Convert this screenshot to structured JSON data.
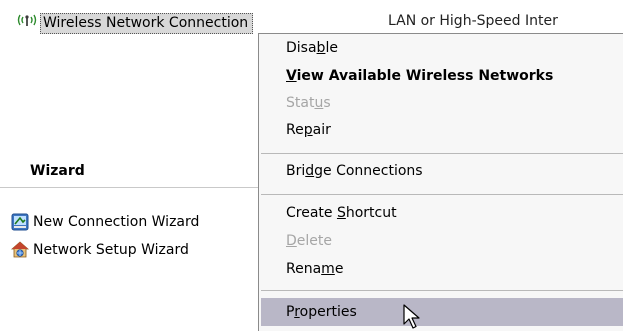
{
  "connection_row": {
    "name": "Wireless Network Connection",
    "type_prefix": "LAN or High-Speed Inter",
    "icon": "wireless-signal-icon"
  },
  "wizard_panel": {
    "heading": "Wizard",
    "items": [
      {
        "label": "New Connection Wizard",
        "icon": "new-connection-wizard-icon"
      },
      {
        "label": "Network Setup Wizard",
        "icon": "network-setup-wizard-icon"
      }
    ]
  },
  "context_menu": {
    "items": [
      {
        "label_pre": "Disa",
        "label_u": "b",
        "label_post": "le",
        "state": "enabled"
      },
      {
        "label_pre": "",
        "label_u": "V",
        "label_post": "iew Available Wireless Networks",
        "state": "default"
      },
      {
        "label_pre": "Stat",
        "label_u": "u",
        "label_post": "s",
        "state": "disabled"
      },
      {
        "label_pre": "Re",
        "label_u": "p",
        "label_post": "air",
        "state": "enabled"
      },
      {
        "label_pre": "Bri",
        "label_u": "d",
        "label_post": "ge Connections",
        "state": "enabled"
      },
      {
        "label_pre": "Create ",
        "label_u": "S",
        "label_post": "hortcut",
        "state": "enabled"
      },
      {
        "label_pre": "",
        "label_u": "D",
        "label_post": "elete",
        "state": "disabled"
      },
      {
        "label_pre": "Rena",
        "label_u": "m",
        "label_post": "e",
        "state": "enabled"
      },
      {
        "label_pre": "P",
        "label_u": "r",
        "label_post": "operties",
        "state": "highlighted"
      }
    ]
  },
  "colors": {
    "menu_background": "#f7f7f7",
    "highlight": "#b9b7c7",
    "disabled_text": "#a6a6a6",
    "selected_name_background": "#d8d8d8"
  },
  "cursor": {
    "icon": "mouse-pointer-icon"
  }
}
